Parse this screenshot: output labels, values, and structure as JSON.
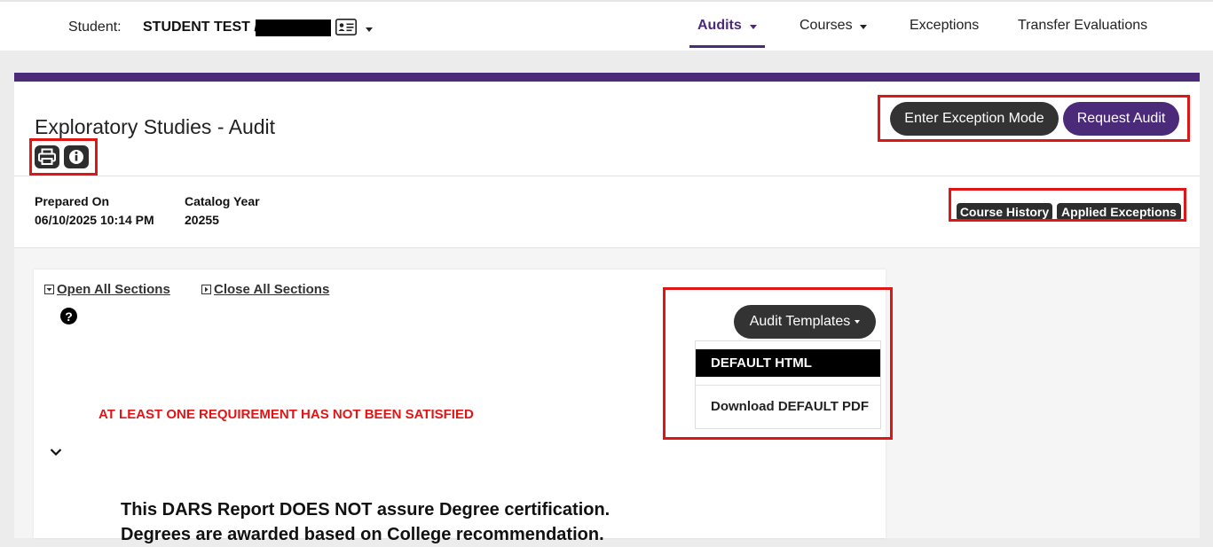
{
  "header": {
    "student_label": "Student:",
    "student_name": "STUDENT TEST /",
    "nav": [
      {
        "label": "Audits",
        "active": true,
        "has_dropdown": true
      },
      {
        "label": "Courses",
        "has_dropdown": true
      },
      {
        "label": "Exceptions"
      },
      {
        "label": "Transfer Evaluations"
      }
    ]
  },
  "audit": {
    "title": "Exploratory Studies - Audit",
    "buttons": {
      "exception_mode": "Enter Exception Mode",
      "request_audit": "Request Audit"
    },
    "meta": {
      "prepared_on_label": "Prepared On",
      "prepared_on_value": "06/10/2025 10:14 PM",
      "catalog_year_label": "Catalog Year",
      "catalog_year_value": "20255"
    },
    "badges": {
      "course_history": "Course History",
      "applied_exceptions": "Applied Exceptions"
    }
  },
  "sections": {
    "open_all": "Open All Sections",
    "close_all": "Close All Sections",
    "help_glyph": "?",
    "warning": "AT LEAST ONE REQUIREMENT HAS NOT BEEN SATISFIED",
    "disclaimer_line1": "This DARS Report DOES NOT assure Degree certification.",
    "disclaimer_line2": "Degrees are awarded based on College recommendation."
  },
  "templates": {
    "button_label": "Audit Templates",
    "options": [
      "DEFAULT HTML",
      "Download DEFAULT PDF"
    ],
    "selected": "DEFAULT HTML"
  },
  "colors": {
    "brand_purple": "#4b2a7a",
    "highlight_red": "#e01616",
    "dark_button": "#333333"
  }
}
